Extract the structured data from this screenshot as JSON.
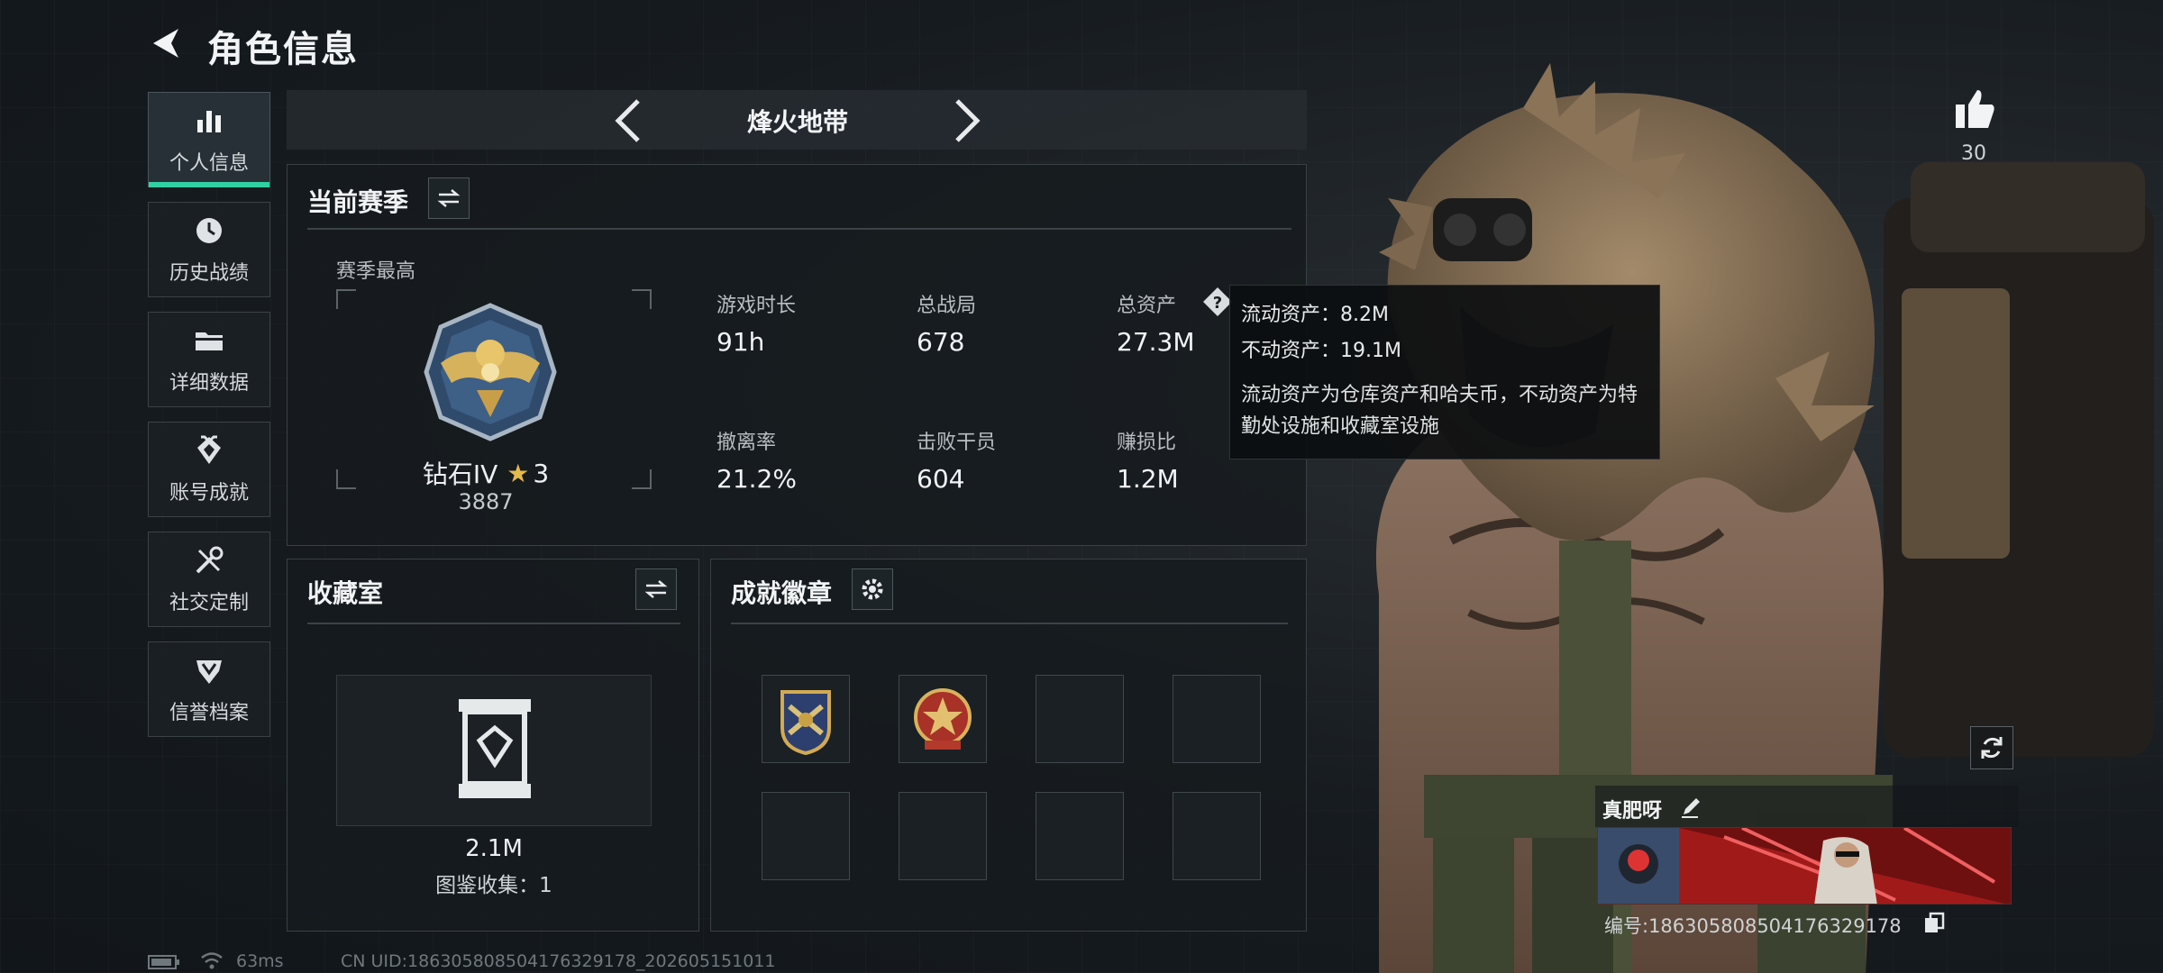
{
  "header": {
    "title": "角色信息"
  },
  "sidebar": {
    "items": [
      {
        "label": "个人信息",
        "icon": "bar-chart-icon"
      },
      {
        "label": "历史战绩",
        "icon": "clock-icon"
      },
      {
        "label": "详细数据",
        "icon": "folder-icon"
      },
      {
        "label": "账号成就",
        "icon": "achievement-icon"
      },
      {
        "label": "社交定制",
        "icon": "wrench-icon"
      },
      {
        "label": "信誉档案",
        "icon": "shield-icon"
      }
    ]
  },
  "mode": {
    "title": "烽火地带"
  },
  "season": {
    "title": "当前赛季",
    "best_label": "赛季最高",
    "rank_name": "钻石IV",
    "rank_stars": "3",
    "rank_points": "3887",
    "stats": [
      {
        "label": "游戏时长",
        "value": "91h"
      },
      {
        "label": "总战局",
        "value": "678"
      },
      {
        "label": "总资产",
        "value": "27.3M"
      },
      {
        "label": "撤离率",
        "value": "21.2%"
      },
      {
        "label": "击败干员",
        "value": "604"
      },
      {
        "label": "赚损比",
        "value": "1.2M"
      }
    ]
  },
  "tooltip": {
    "liquid": "流动资产：8.2M",
    "fixed": "不动资产：19.1M",
    "note": "流动资产为仓库资产和哈夫币，不动资产为特勤处设施和收藏室设施"
  },
  "collection": {
    "title": "收藏室",
    "value": "2.1M",
    "count_label": "图鉴收集：1"
  },
  "badges": {
    "title": "成就徽章"
  },
  "likes": {
    "count": "30"
  },
  "player": {
    "nickname": "真肥呀",
    "id_text": "编号:186305808504176329178"
  },
  "status": {
    "ping": "63ms",
    "uid": "CN UID:186305808504176329178_202605151011"
  },
  "colors": {
    "accent": "#2fd1a3",
    "star": "#e5b94a",
    "card_red": "#9c1c1c"
  }
}
